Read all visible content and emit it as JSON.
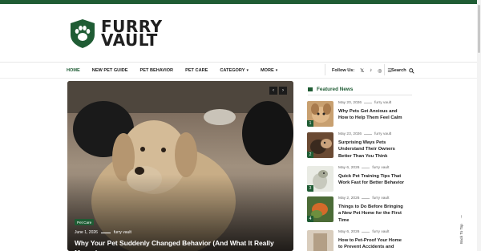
{
  "brand": {
    "line1": "FURRY",
    "line2": "VAULT",
    "color": "#1f5c34"
  },
  "nav": {
    "items": [
      {
        "label": "HOME",
        "active": true
      },
      {
        "label": "NEW PET GUIDE"
      },
      {
        "label": "PET BEHAVIOR"
      },
      {
        "label": "PET CARE"
      },
      {
        "label": "CATEGORY",
        "dropdown": true
      },
      {
        "label": "MORE",
        "dropdown": true
      }
    ],
    "follow_label": "Follow Us:",
    "social_icons": [
      "x-icon",
      "tiktok-icon",
      "instagram-icon",
      "rss-icon"
    ],
    "search_label": "Search"
  },
  "hero": {
    "badge": "Pet Care",
    "date": "June 1, 2026",
    "author": "furry vault",
    "title": "Why Your Pet Suddenly Changed Behavior (And What It Really Means)"
  },
  "featured": {
    "heading": "Featured News",
    "items": [
      {
        "num": "1",
        "date": "May 20, 2026",
        "author": "furry vault",
        "title": "Why Pets Get Anxious and How to Help Them Feel Calm"
      },
      {
        "num": "2",
        "date": "May 23, 2026",
        "author": "furry vault",
        "title": "Surprising Ways Pets Understand Their Owners Better Than You Think"
      },
      {
        "num": "3",
        "date": "May 6, 2026",
        "author": "furry vault",
        "title": "Quick Pet Training Tips That Work Fast for Better Behavior"
      },
      {
        "num": "4",
        "date": "May 2, 2026",
        "author": "furry vault",
        "title": "Things to Do Before Bringing a New Pet Home for the First Time"
      },
      {
        "num": "5",
        "date": "May 6, 2026",
        "author": "furry vault",
        "title": "How to Pet-Proof Your Home to Prevent Accidents and"
      }
    ]
  },
  "back_to_top": "Back To Top"
}
